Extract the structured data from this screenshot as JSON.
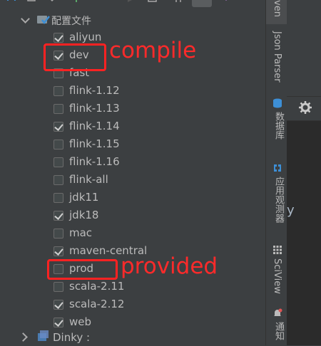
{
  "profiles": {
    "header": {
      "label": "配置文件"
    },
    "items": [
      {
        "label": "aliyun",
        "checked": true
      },
      {
        "label": "dev",
        "checked": true
      },
      {
        "label": "fast",
        "checked": false
      },
      {
        "label": "flink-1.12",
        "checked": false
      },
      {
        "label": "flink-1.13",
        "checked": false
      },
      {
        "label": "flink-1.14",
        "checked": true
      },
      {
        "label": "flink-1.15",
        "checked": false
      },
      {
        "label": "flink-1.16",
        "checked": false
      },
      {
        "label": "flink-all",
        "checked": false
      },
      {
        "label": "jdk11",
        "checked": false
      },
      {
        "label": "jdk18",
        "checked": true
      },
      {
        "label": "mac",
        "checked": false
      },
      {
        "label": "maven-central",
        "checked": true
      },
      {
        "label": "prod",
        "checked": false
      },
      {
        "label": "scala-2.11",
        "checked": false
      },
      {
        "label": "scala-2.12",
        "checked": true
      },
      {
        "label": "web",
        "checked": true
      }
    ],
    "next_node": {
      "label": "Dinky :"
    }
  },
  "sidebar": {
    "tabs": [
      {
        "label": "ven"
      },
      {
        "label": "Json Parser"
      },
      {
        "label": "数据库",
        "icon": "database-icon"
      },
      {
        "label": "应用观测器",
        "icon": "observer-icon"
      },
      {
        "label": "SciView",
        "icon": "sciview-icon"
      },
      {
        "label": "通知",
        "icon": "bell-icon"
      }
    ]
  },
  "right_panel": {
    "fragment": "y",
    "icon": "gear-icon"
  },
  "annotations": {
    "compile": "compile",
    "provided": "provided"
  },
  "colors": {
    "annotation_red": "#ff2222",
    "panel_bg": "#3c3f41"
  }
}
